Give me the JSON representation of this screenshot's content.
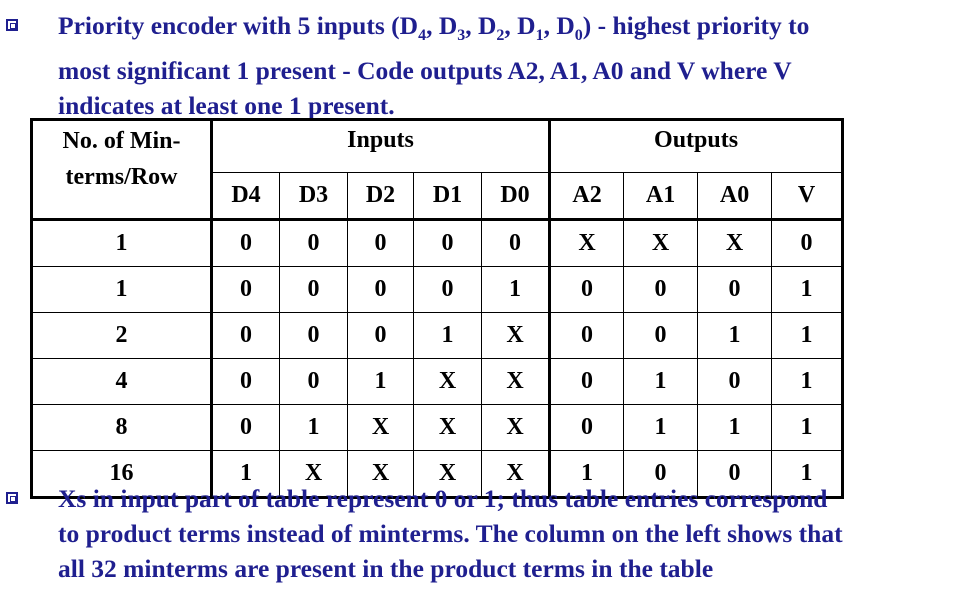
{
  "bullets": {
    "first": {
      "line1_a": "Priority encoder with 5 inputs (D",
      "s4": "4",
      "line1_b": ", D",
      "s3": "3",
      "line1_c": ", D",
      "s2": "2",
      "line1_d": ", D",
      "s1": "1",
      "line1_e": ", D",
      "s0": "0",
      "line1_f": ") - highest priority to",
      "line2": "most significant 1 present - Code outputs A2, A1, A0 and V where V",
      "line3": "indicates at least one 1 present."
    },
    "second": {
      "line1": "Xs in input part of table represent 0 or 1; thus table entries correspond",
      "line2": "to product terms instead of minterms. The column on the left shows that",
      "line3": "all 32 minterms are present in the product terms in the table"
    }
  },
  "table": {
    "corner_line1": "No. of Min-",
    "corner_line2": "terms/Row",
    "group_inputs": "Inputs",
    "group_outputs": "Outputs",
    "columns": [
      "D4",
      "D3",
      "D2",
      "D1",
      "D0",
      "A2",
      "A1",
      "A0",
      "V"
    ],
    "rows": [
      [
        "1",
        "0",
        "0",
        "0",
        "0",
        "0",
        "X",
        "X",
        "X",
        "0"
      ],
      [
        "1",
        "0",
        "0",
        "0",
        "0",
        "1",
        "0",
        "0",
        "0",
        "1"
      ],
      [
        "2",
        "0",
        "0",
        "0",
        "1",
        "X",
        "0",
        "0",
        "1",
        "1"
      ],
      [
        "4",
        "0",
        "0",
        "1",
        "X",
        "X",
        "0",
        "1",
        "0",
        "1"
      ],
      [
        "8",
        "0",
        "1",
        "X",
        "X",
        "X",
        "0",
        "1",
        "1",
        "1"
      ],
      [
        "16",
        "1",
        "X",
        "X",
        "X",
        "X",
        "1",
        "0",
        "0",
        "1"
      ]
    ]
  }
}
